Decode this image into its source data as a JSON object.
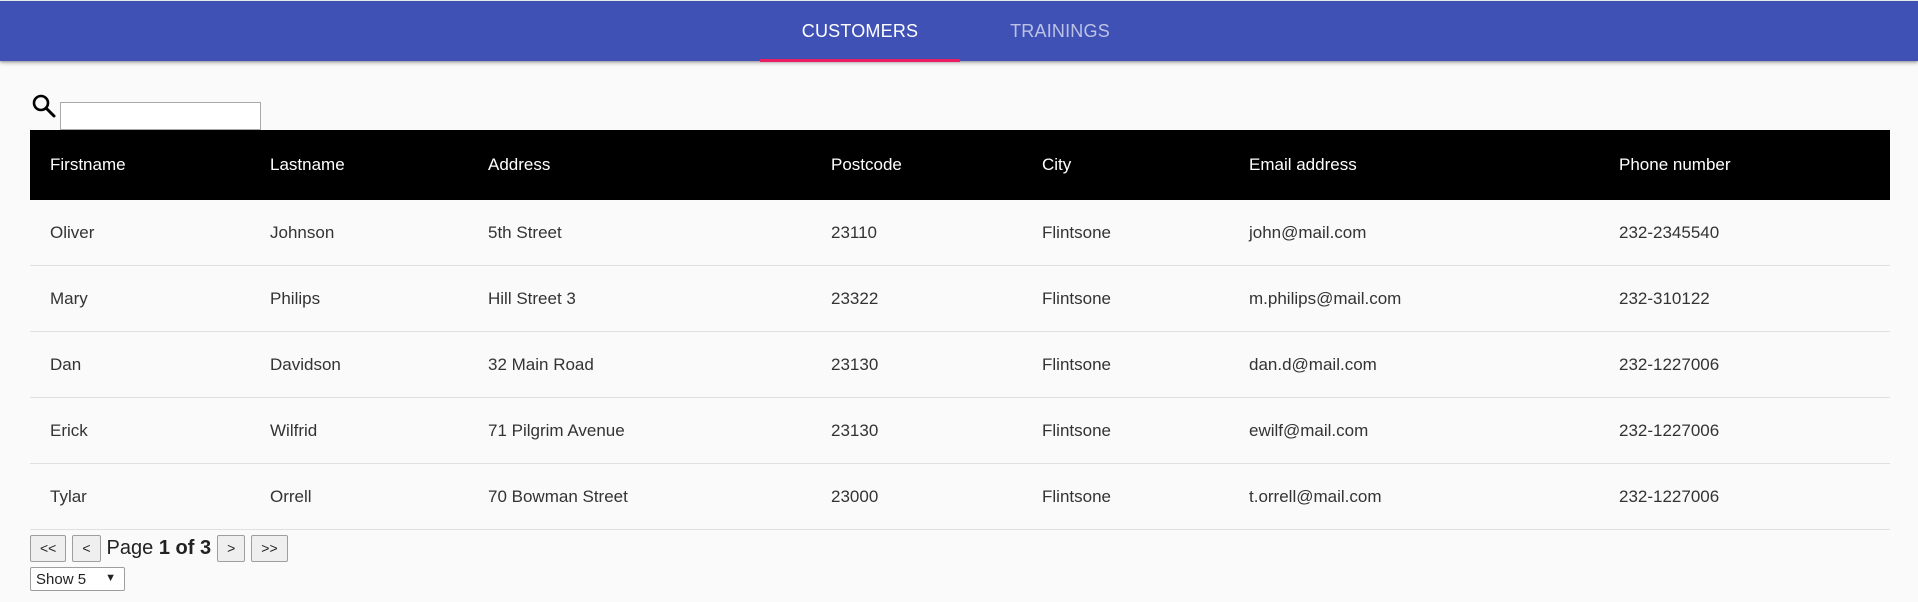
{
  "nav": {
    "tabs": [
      {
        "label": "CUSTOMERS",
        "active": true
      },
      {
        "label": "TRAININGS",
        "active": false
      }
    ]
  },
  "search": {
    "value": "",
    "placeholder": ""
  },
  "table": {
    "headers": [
      "Firstname",
      "Lastname",
      "Address",
      "Postcode",
      "City",
      "Email address",
      "Phone number"
    ],
    "rows": [
      [
        "Oliver",
        "Johnson",
        "5th Street",
        "23110",
        "Flintsone",
        "john@mail.com",
        "232-2345540"
      ],
      [
        "Mary",
        "Philips",
        "Hill Street 3",
        "23322",
        "Flintsone",
        "m.philips@mail.com",
        "232-310122"
      ],
      [
        "Dan",
        "Davidson",
        "32 Main Road",
        "23130",
        "Flintsone",
        "dan.d@mail.com",
        "232-1227006"
      ],
      [
        "Erick",
        "Wilfrid",
        "71 Pilgrim Avenue",
        "23130",
        "Flintsone",
        "ewilf@mail.com",
        "232-1227006"
      ],
      [
        "Tylar",
        "Orrell",
        "70 Bowman Street",
        "23000",
        "Flintsone",
        "t.orrell@mail.com",
        "232-1227006"
      ]
    ]
  },
  "pagination": {
    "first_label": "<<",
    "prev_label": "<",
    "page_word": "Page",
    "current_page": "1",
    "of_word": "of",
    "total_pages": "3",
    "next_label": ">",
    "last_label": ">>",
    "page_size_label": "Show 5"
  },
  "colors": {
    "appbar": "#3f51b5",
    "tab_indicator": "#e91e63",
    "table_header": "#000000"
  },
  "icons": {
    "search": "search-icon",
    "dropdown": "caret-down-icon"
  }
}
